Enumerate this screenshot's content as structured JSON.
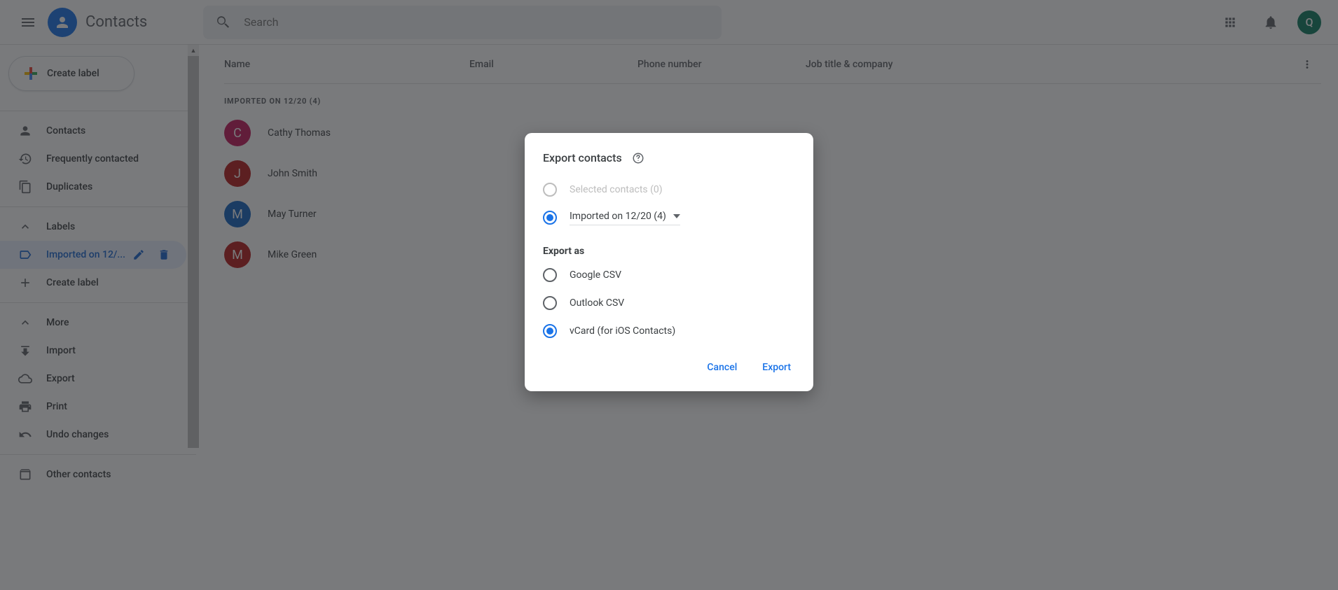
{
  "header": {
    "app_title": "Contacts",
    "search_placeholder": "Search",
    "avatar_letter": "Q"
  },
  "sidebar": {
    "create_label": "Create label",
    "nav": {
      "contacts": "Contacts",
      "frequent": "Frequently contacted",
      "duplicates": "Duplicates"
    },
    "labels_header": "Labels",
    "label_imported": "Imported on 12/...",
    "more": "More",
    "import": "Import",
    "export": "Export",
    "print": "Print",
    "undo": "Undo changes",
    "other": "Other contacts"
  },
  "table": {
    "col_name": "Name",
    "col_email": "Email",
    "col_phone": "Phone number",
    "col_job": "Job title & company",
    "group_header": "IMPORTED ON 12/20 (4)",
    "rows": [
      {
        "initial": "C",
        "name": "Cathy Thomas",
        "color": "#c2185b"
      },
      {
        "initial": "J",
        "name": "John Smith",
        "color": "#b71c1c"
      },
      {
        "initial": "M",
        "name": "May Turner",
        "color": "#1565c0"
      },
      {
        "initial": "M",
        "name": "Mike Green",
        "color": "#b71c1c"
      }
    ]
  },
  "dialog": {
    "title": "Export contacts",
    "option_selected": "Selected contacts (0)",
    "option_imported": "Imported on 12/20 (4)",
    "section_export_as": "Export as",
    "format_google": "Google CSV",
    "format_outlook": "Outlook CSV",
    "format_vcard": "vCard (for iOS Contacts)",
    "cancel": "Cancel",
    "export": "Export"
  }
}
